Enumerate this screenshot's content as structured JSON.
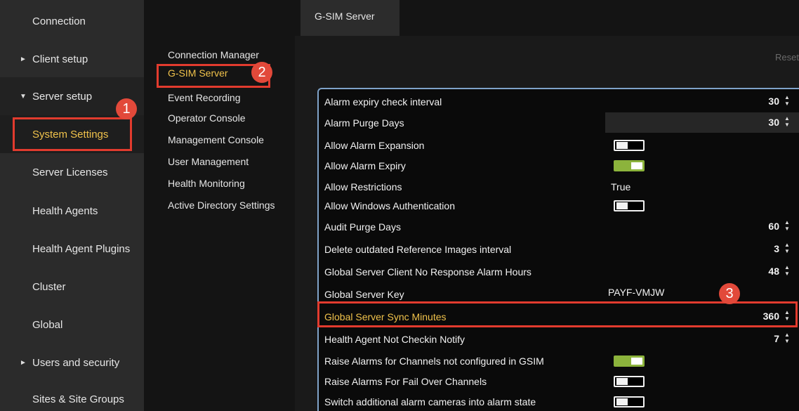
{
  "left_nav": {
    "items": [
      {
        "label": "Connection",
        "arrow": ""
      },
      {
        "label": "Client setup",
        "arrow": "►"
      },
      {
        "label": "Server setup",
        "arrow": "▼"
      },
      {
        "label": "System Settings",
        "arrow": ""
      },
      {
        "label": "Server Licenses",
        "arrow": ""
      },
      {
        "label": "Health Agents",
        "arrow": ""
      },
      {
        "label": "Health Agent Plugins",
        "arrow": ""
      },
      {
        "label": "Cluster",
        "arrow": ""
      },
      {
        "label": "Global",
        "arrow": ""
      },
      {
        "label": "Users and security",
        "arrow": "►"
      },
      {
        "label": "Sites & Site Groups",
        "arrow": ""
      }
    ]
  },
  "mid_menu": {
    "items": [
      "Connection Manager",
      "G-SIM Server",
      "Event Recording",
      "Operator Console",
      "Management Console",
      "User Management",
      "Health Monitoring",
      "Active Directory Settings"
    ]
  },
  "tab": {
    "label": "G-SIM Server"
  },
  "reset_label": "Reset",
  "settings": [
    {
      "name": "Alarm expiry check interval",
      "value": "30",
      "type": "number"
    },
    {
      "name": "Alarm Purge Days",
      "value": "30",
      "type": "number"
    },
    {
      "name": "Allow Alarm Expansion",
      "value": "off",
      "type": "toggle"
    },
    {
      "name": "Allow Alarm Expiry",
      "value": "on",
      "type": "toggle"
    },
    {
      "name": "Allow Restrictions",
      "value": "True",
      "type": "text"
    },
    {
      "name": "Allow Windows Authentication",
      "value": "off",
      "type": "toggle"
    },
    {
      "name": "Audit Purge Days",
      "value": "60",
      "type": "number"
    },
    {
      "name": "Delete outdated Reference Images interval",
      "value": "3",
      "type": "number"
    },
    {
      "name": "Global Server Client No Response Alarm Hours",
      "value": "48",
      "type": "number"
    },
    {
      "name": "Global Server Key",
      "value": "PAYF-VMJW",
      "type": "text"
    },
    {
      "name": "Global Server Sync Minutes",
      "value": "360",
      "type": "number"
    },
    {
      "name": "Health Agent Not Checkin Notify",
      "value": "7",
      "type": "number"
    },
    {
      "name": "Raise Alarms for Channels not configured in GSIM",
      "value": "on",
      "type": "toggle"
    },
    {
      "name": "Raise Alarms For Fail Over Channels",
      "value": "off",
      "type": "toggle"
    },
    {
      "name": "Switch additional alarm cameras into alarm state",
      "value": "off",
      "type": "toggle"
    }
  ],
  "annotations": {
    "badge1": "1",
    "badge2": "2",
    "badge3": "3"
  },
  "colors": {
    "accent": "#f0c24b",
    "toggle_on": "#8cb33c",
    "annotation_red": "#e23b2e",
    "grid_border": "#7fa3c9"
  }
}
